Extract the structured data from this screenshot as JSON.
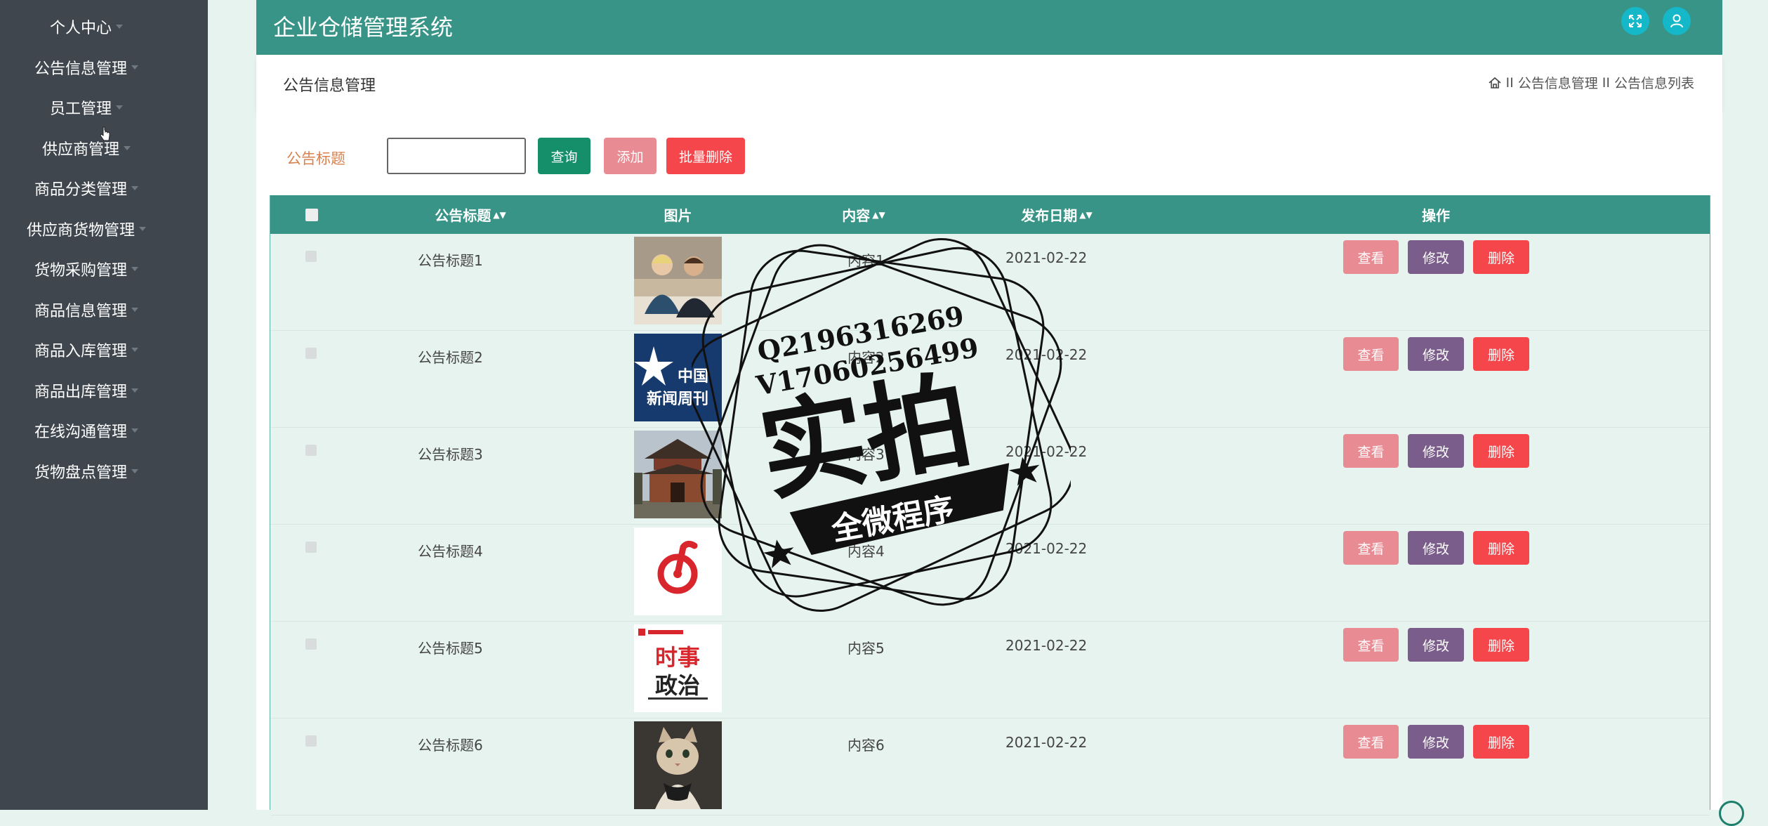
{
  "sidebar": {
    "items": [
      {
        "label": "个人中心"
      },
      {
        "label": "公告信息管理"
      },
      {
        "label": "员工管理"
      },
      {
        "label": "供应商管理"
      },
      {
        "label": "商品分类管理"
      },
      {
        "label": "供应商货物管理"
      },
      {
        "label": "货物采购管理"
      },
      {
        "label": "商品信息管理"
      },
      {
        "label": "商品入库管理"
      },
      {
        "label": "商品出库管理"
      },
      {
        "label": "在线沟通管理"
      },
      {
        "label": "货物盘点管理"
      }
    ]
  },
  "header": {
    "title": "企业仓储管理系统",
    "icons": [
      "fullscreen-icon",
      "user-icon"
    ]
  },
  "breadcrumb": {
    "page_title": "公告信息管理",
    "sep1": "II",
    "crumb1": "公告信息管理",
    "sep2": "II",
    "crumb2": "公告信息列表"
  },
  "search": {
    "label": "公告标题",
    "value": "",
    "query_button": "查询",
    "add_button": "添加",
    "batch_delete_button": "批量删除"
  },
  "table": {
    "columns": {
      "title": "公告标题",
      "image": "图片",
      "content": "内容",
      "date": "发布日期",
      "actions": "操作"
    },
    "rows": [
      {
        "title": "公告标题1",
        "content": "内容1",
        "date": "2021-02-22",
        "image": "photo-two-people"
      },
      {
        "title": "公告标题2",
        "content": "内容2",
        "date": "2021-02-22",
        "image": "china-news-weekly-logo",
        "image_text_1": "中国",
        "image_text_2": "新闻周刊"
      },
      {
        "title": "公告标题3",
        "content": "内容3",
        "date": "2021-02-22",
        "image": "photo-temple"
      },
      {
        "title": "公告标题4",
        "content": "内容4",
        "date": "2021-02-22",
        "image": "netease-music-logo"
      },
      {
        "title": "公告标题5",
        "content": "内容5",
        "date": "2021-02-22",
        "image": "current-politics-magazine",
        "image_text_1": "时事",
        "image_text_2": "政治"
      },
      {
        "title": "公告标题6",
        "content": "内容6",
        "date": "2021-02-22",
        "image": "photo-cat"
      }
    ],
    "actions": {
      "view": "查看",
      "edit": "修改",
      "delete": "删除"
    }
  },
  "watermark": {
    "line1": "Q2196316269",
    "line2": "V17060256499",
    "main": "实拍",
    "banner": "全微程序"
  },
  "colors": {
    "sidebar_bg": "#3f464e",
    "header_bg": "#389486",
    "accent_teal": "#148f6a",
    "view_btn": "#e88b93",
    "edit_btn": "#7a5d8a",
    "delete_btn": "#f5474b",
    "page_bg": "#e7f3ef"
  }
}
